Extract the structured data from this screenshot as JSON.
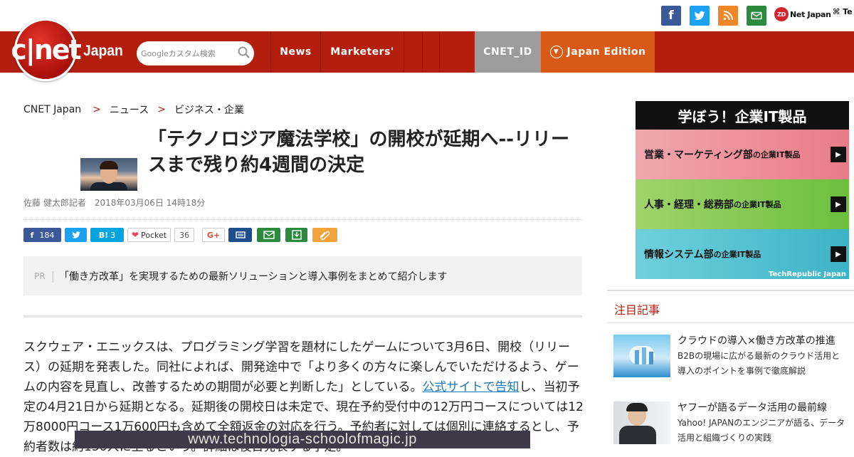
{
  "social": {
    "facebook": "f",
    "twitter": "t",
    "rss": "rss",
    "mail": "mail",
    "zdnet_label": "Net Japan",
    "zdnet_logo": "ZD",
    "techrepublic_label": "Te"
  },
  "header": {
    "logo_text": "c|net",
    "edition_word": "Japan",
    "search_placeholder": "Googleカスタム検索",
    "nav": [
      "News",
      "Marketers'",
      "",
      ""
    ],
    "cnet_id": "CNET_ID",
    "edition": "Japan Edition"
  },
  "breadcrumb": [
    "CNET Japan",
    "ニュース",
    "ビジネス・企業"
  ],
  "article": {
    "title": "「テクノロジア魔法学校」の開校が延期へ--リリースまで残り約4週間の決定",
    "byline": "佐藤 健太郎記者　2018年03月06日 14時18分",
    "share": {
      "facebook_count": "184",
      "hatena_label": "B!",
      "hatena_count": "3",
      "pocket_label": "Pocket",
      "pocket_count": "36",
      "gplus": "G+"
    },
    "pr_label": "PR",
    "pr_text": "「働き方改革」を実現するための最新ソリューションと導入事例をまとめて紹介します",
    "body_1": "スクウェア・エニックスは、プログラミング学習を題材にしたゲームについて3月6日、開校（リリース）の延期を発表した。同社によれば、開発途中で「より多くの方々に楽しんでいただけるよう、ゲームの内容を見直し、改善するための期間が必要と判断した」としている。",
    "body_link": "公式サイトで告知",
    "body_2": "し、当初予定の4月21日から延期となる。延期後の開校日は未定で、現在予約受付中の12万円コースについては12万8000円コース1万600円も含めて全額返金の対応を行う。予約者に対しては個別に連絡するとし、予約者数は約150人に上るという。詳細は後日発表する予定。",
    "photo_caption": "www.technologia-schoolofmagic.jp"
  },
  "sidebar": {
    "ad_title": "学ぼう！企業IT製品",
    "ad_rows": [
      {
        "label": "営業・マーケティング部",
        "suffix": "の企業IT製品"
      },
      {
        "label": "人事・経理・総務部",
        "suffix": "の企業IT製品"
      },
      {
        "label": "情報システム部",
        "suffix": "の企業IT製品"
      }
    ],
    "ad_footer": "TechRepublic Japan",
    "heading": "注目記事",
    "items": [
      {
        "title": "クラウドの導入×働き方改革の推進",
        "desc": "B2Bの現場に広がる最新のクラウド活用と導入のポイントを事例で徹底解説"
      },
      {
        "title": "ヤフーが語るデータ活用の最前線",
        "desc": "Yahoo! JAPANのエンジニアが語る、データ活用と組織づくりの実践"
      }
    ]
  },
  "colors": {
    "brand_red": "#b41e0c",
    "edition_orange": "#d85a16",
    "id_gray": "#9c9c9c",
    "link_blue": "#1a7ab8"
  }
}
